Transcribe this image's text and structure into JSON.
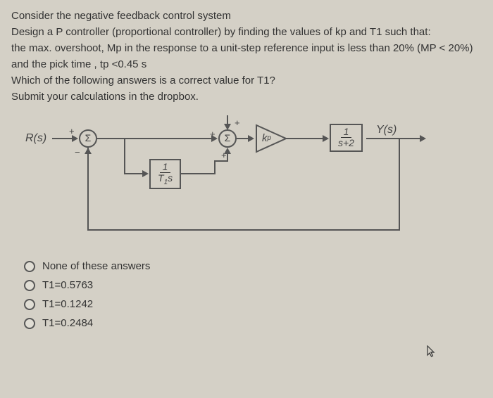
{
  "question": {
    "line1": "Consider the negative feedback control system",
    "line2": "Design a P controller (proportional controller) by finding the values of kp and T1 such that:",
    "line3": "the max. overshoot, Mp in the response to a unit-step reference input is less than 20%  (MP < 20%)",
    "line4": "and the pick time , tp <0.45 s",
    "line5": "Which of the following answers is a correct value for T1?",
    "line6": "Submit your calculations in the dropbox."
  },
  "diagram": {
    "input_label": "R(s)",
    "output_label": "Y(s)",
    "sum1": "Σ",
    "sum2": "Σ",
    "gain": "k",
    "gain_sub": "p",
    "plant_num": "1",
    "plant_den": "s+2",
    "fb_num": "1",
    "fb_den_a": "T",
    "fb_den_b": "1",
    "fb_den_c": "s",
    "plus": "+",
    "minus": "−"
  },
  "options": [
    {
      "label": "None of these answers"
    },
    {
      "label": "T1=0.5763"
    },
    {
      "label": "T1=0.1242"
    },
    {
      "label": "T1=0.2484"
    }
  ]
}
